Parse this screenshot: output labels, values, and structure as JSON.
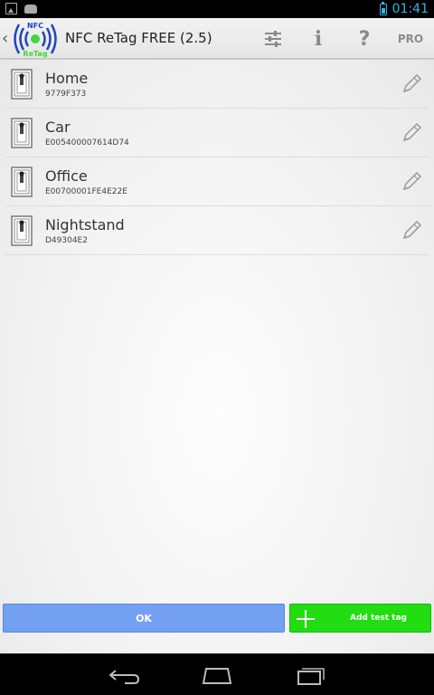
{
  "status_bar": {
    "time": "01:41",
    "icons": [
      "gallery-icon",
      "bag-icon",
      "battery-icon"
    ]
  },
  "action_bar": {
    "title": "NFC ReTag FREE (2.5)",
    "logo": {
      "top_text": "NFC",
      "bottom_text": "ReTag"
    },
    "buttons": {
      "settings_icon": "sliders-icon",
      "info": "i",
      "help": "?",
      "pro": "PRO"
    }
  },
  "tags": [
    {
      "name": "Home",
      "id": "9779F373"
    },
    {
      "name": "Car",
      "id": "E005400007614D74"
    },
    {
      "name": "Office",
      "id": "E00700001FE4E22E"
    },
    {
      "name": "Nightstand",
      "id": "D49304E2"
    }
  ],
  "buttons": {
    "ok": "OK",
    "add_test_tag": "Add test tag"
  },
  "colors": {
    "status_accent": "#33b5e5",
    "ok_button": "#74a0f2",
    "add_button": "#22dd11"
  }
}
